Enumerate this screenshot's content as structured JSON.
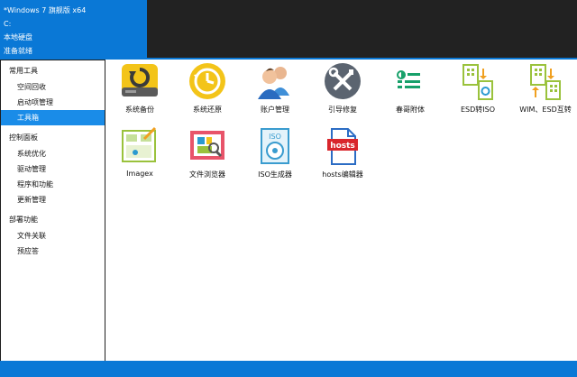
{
  "header": {
    "os_title": "*Windows 7 旗舰版 x64",
    "drive": "C:",
    "disk_type": "本地硬盘",
    "status": "准备就绪"
  },
  "sidebar": {
    "groups": [
      {
        "label": "常用工具",
        "items": [
          "空间回收",
          "启动项管理",
          "工具箱"
        ]
      },
      {
        "label": "控制面板",
        "items": [
          "系统优化",
          "驱动管理",
          "程序和功能",
          "更新管理"
        ]
      },
      {
        "label": "部署功能",
        "items": [
          "文件关联",
          "预应答"
        ]
      }
    ],
    "selected": "工具箱"
  },
  "tools": [
    {
      "label": "系统备份",
      "icon": "backup-icon"
    },
    {
      "label": "系统还原",
      "icon": "restore-clock-icon"
    },
    {
      "label": "账户管理",
      "icon": "users-icon"
    },
    {
      "label": "引导修复",
      "icon": "wrench-screwdriver-icon"
    },
    {
      "label": "春哥附体",
      "icon": "toggle-list-icon"
    },
    {
      "label": "ESD转ISO",
      "icon": "esd-iso-icon"
    },
    {
      "label": "WIM、ESD互转",
      "icon": "wim-esd-icon"
    },
    {
      "label": "Imagex",
      "icon": "imagex-icon"
    },
    {
      "label": "文件浏览器",
      "icon": "file-browser-icon"
    },
    {
      "label": "ISO生成器",
      "icon": "iso-disc-icon"
    },
    {
      "label": "hosts编辑器",
      "icon": "hosts-file-icon"
    }
  ],
  "hosts_icon_text": "hosts",
  "iso_icon_text": "ISO",
  "colors": {
    "accent": "#0a78d6",
    "selected": "#1a8ce8",
    "dark": "#222222"
  }
}
